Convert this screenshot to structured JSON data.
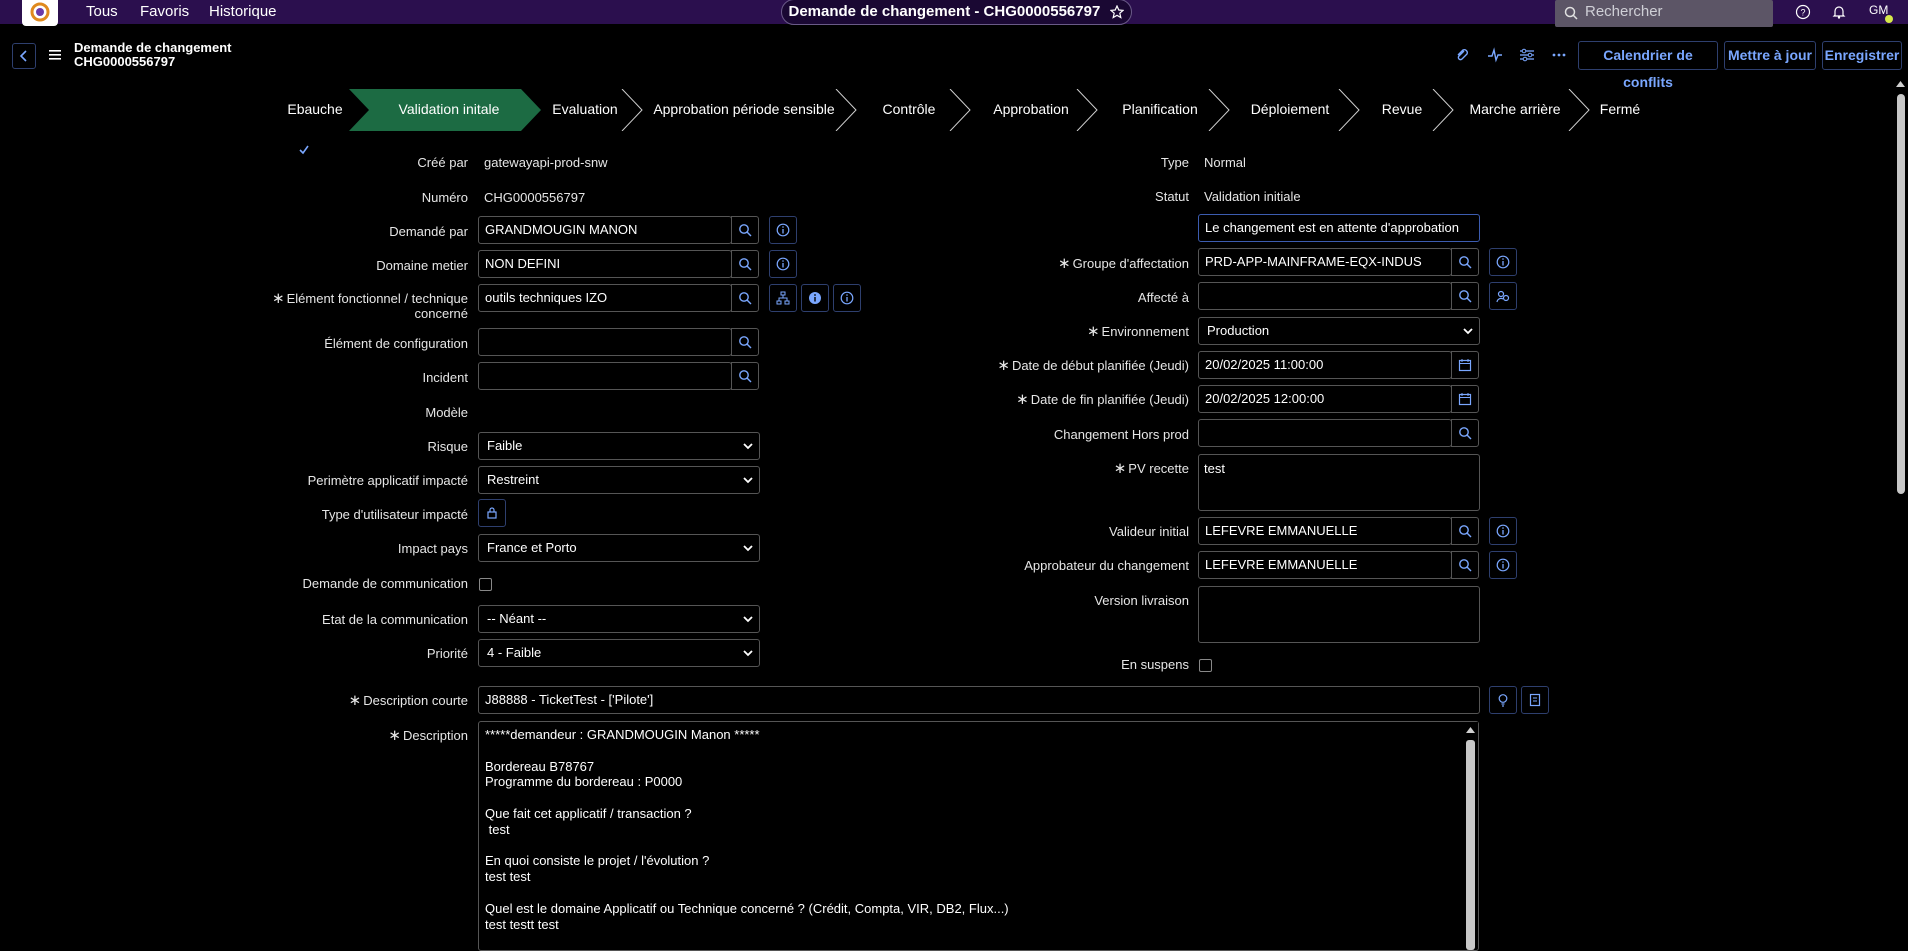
{
  "topbar": {
    "nav": [
      "Tous",
      "Favoris",
      "Historique"
    ],
    "title_pill": "Demande de changement - CHG0000556797",
    "search_placeholder": "Rechercher",
    "avatar": "GM",
    "icons": [
      "help-icon",
      "bell-icon",
      "star-icon",
      "search-icon"
    ]
  },
  "header": {
    "form_type": "Demande de changement",
    "record_number": "CHG0000556797",
    "buttons": {
      "conflicts": "Calendrier de conflits",
      "update": "Mettre à jour",
      "save": "Enregistrer"
    }
  },
  "stages": {
    "items": [
      "Ebauche",
      "Validation initale",
      "Evaluation",
      "Approbation période sensible",
      "Contrôle",
      "Approbation",
      "Planification",
      "Déploiement",
      "Revue",
      "Marche arrière",
      "Fermé"
    ],
    "completed": "Ebauche",
    "active": "Validation initale",
    "active_color": "#1c6b43"
  },
  "left": {
    "cree_par": {
      "label": "Créé par",
      "value": "gatewayapi-prod-snw"
    },
    "numero": {
      "label": "Numéro",
      "value": "CHG0000556797"
    },
    "demande_par": {
      "label": "Demandé par",
      "value": "GRANDMOUGIN MANON"
    },
    "domaine": {
      "label": "Domaine metier",
      "value": "NON DEFINI"
    },
    "element_fonc": {
      "label_line1": "Elément fonctionnel / technique",
      "label_line2": "concerné",
      "value": "outils techniques IZO"
    },
    "element_config": {
      "label": "Élément de configuration",
      "value": ""
    },
    "incident": {
      "label": "Incident",
      "value": ""
    },
    "modele": {
      "label": "Modèle"
    },
    "risque": {
      "label": "Risque",
      "value": "Faible"
    },
    "perimetre": {
      "label": "Perimètre applicatif impacté",
      "value": "Restreint"
    },
    "type_util": {
      "label": "Type d'utilisateur impacté"
    },
    "impact_pays": {
      "label": "Impact pays",
      "value": "France et Porto"
    },
    "demande_comm": {
      "label": "Demande de communication",
      "checked": false
    },
    "etat_comm": {
      "label": "Etat de la communication",
      "value": "-- Néant --"
    },
    "priorite": {
      "label": "Priorité",
      "value": "4 - Faible"
    }
  },
  "right": {
    "type": {
      "label": "Type",
      "value": "Normal"
    },
    "statut": {
      "label": "Statut",
      "value": "Validation initiale"
    },
    "approval_note": "Le changement est en attente d'approbation",
    "groupe": {
      "label": "Groupe d'affectation",
      "value": "PRD-APP-MAINFRAME-EQX-INDUS"
    },
    "affecte": {
      "label": "Affecté à",
      "value": ""
    },
    "environnement": {
      "label": "Environnement",
      "value": "Production"
    },
    "date_debut": {
      "label": "Date de début planifiée (Jeudi)",
      "value": "20/02/2025 11:00:00"
    },
    "date_fin": {
      "label": "Date de fin planifiée (Jeudi)",
      "value": "20/02/2025 12:00:00"
    },
    "hors_prod": {
      "label": "Changement Hors prod",
      "value": ""
    },
    "pv_recette": {
      "label": "PV recette",
      "value": "test"
    },
    "valideur": {
      "label": "Valideur initial",
      "value": "LEFEVRE EMMANUELLE"
    },
    "approbateur": {
      "label": "Approbateur du changement",
      "value": "LEFEVRE EMMANUELLE"
    },
    "version": {
      "label": "Version livraison",
      "value": ""
    },
    "suspens": {
      "label": "En suspens",
      "checked": false
    }
  },
  "short_desc": {
    "label": "Description courte",
    "value": "J88888 - TicketTest - ['Pilote']"
  },
  "description": {
    "label": "Description",
    "value": "*****demandeur : GRANDMOUGIN Manon *****\n\nBordereau B78767\nProgramme du bordereau : P0000\n\nQue fait cet applicatif / transaction ?\n test\n\nEn quoi consiste le projet / l'évolution ?\ntest test\n\nQuel est le domaine Applicatif ou Technique concerné ? (Crédit, Compta, VIR, DB2, Flux...)\ntest testt test"
  },
  "colors": {
    "accent": "#7aa7ff",
    "topbar": "#2b0f4e",
    "stage_active": "#1c6b43",
    "border": "#555555"
  }
}
